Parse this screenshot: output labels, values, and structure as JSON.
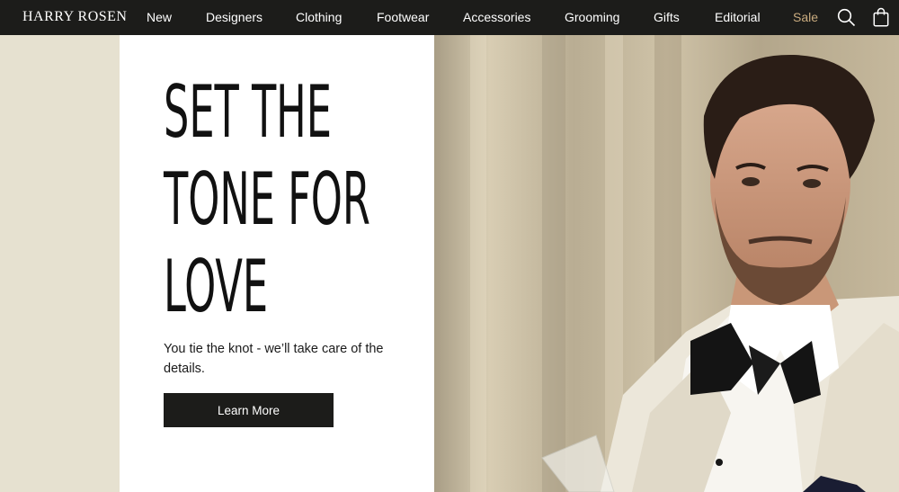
{
  "brand": {
    "name": "HARRY ROSEN"
  },
  "nav": {
    "items": [
      "New",
      "Designers",
      "Clothing",
      "Footwear",
      "Accessories",
      "Grooming",
      "Gifts",
      "Editorial"
    ],
    "sale_label": "Sale",
    "sale_color": "#c9ab7f",
    "icons": [
      "search-icon",
      "shopping-bag-icon"
    ]
  },
  "hero": {
    "headline_line1": "SET THE",
    "headline_line2": "TONE FOR",
    "headline_line3": "LOVE",
    "subtext": "You tie the knot - we’ll take care of the details.",
    "cta_label": "Learn More",
    "image": "man in ivory dinner jacket and black bow tie holding champagne flute"
  },
  "colors": {
    "nav_bg": "#1c1c1a",
    "page_bg": "#e6e1d0",
    "panel_bg": "#ffffff",
    "button_bg": "#1c1c1a"
  }
}
